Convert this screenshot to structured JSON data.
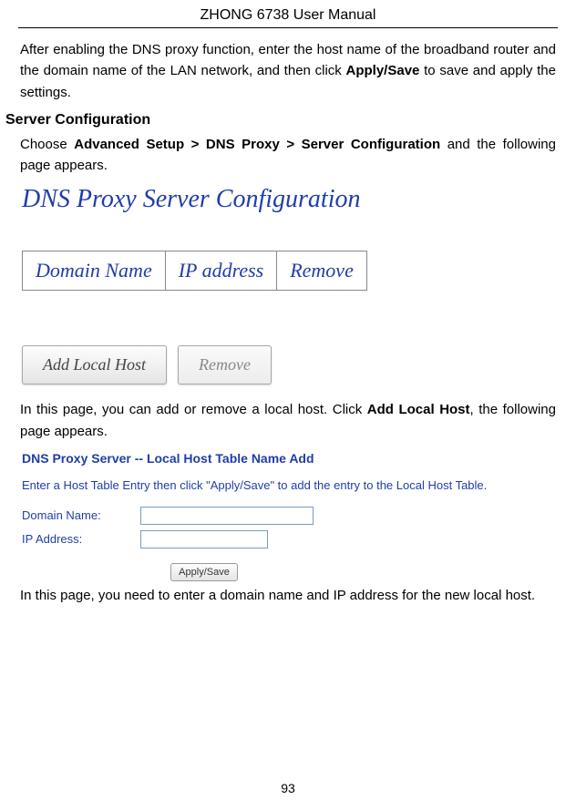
{
  "doc_title": "ZHONG 6738 User Manual",
  "page_number": "93",
  "para1_a": "After enabling the DNS proxy function, enter the host name of the broadband router and the domain name of the LAN network, and then click ",
  "para1_bold": "Apply/Save",
  "para1_b": " to save and apply the settings.",
  "heading1": "Server Configuration",
  "para2_a": "Choose ",
  "para2_bold": "Advanced Setup > DNS Proxy > Server Configuration",
  "para2_b": " and the following page appears.",
  "fig1": {
    "title": "DNS Proxy Server Configuration",
    "headers": [
      "Domain Name",
      "IP address",
      "Remove"
    ],
    "btn_add": "Add Local Host",
    "btn_remove": "Remove"
  },
  "para3_a": "In this page, you can add or remove a local host. Click ",
  "para3_bold": "Add Local Host",
  "para3_b": ", the following page appears.",
  "fig2": {
    "title": "DNS Proxy Server -- Local Host Table Name Add",
    "hint": "Enter a Host Table Entry then click \"Apply/Save\" to add the entry to the Local Host Table.",
    "label_domain": "Domain Name:",
    "label_ip": "IP Address:",
    "value_domain": "",
    "value_ip": "",
    "btn_apply": "Apply/Save"
  },
  "para4": "In this page, you need to enter a domain name and IP address for the new local host."
}
